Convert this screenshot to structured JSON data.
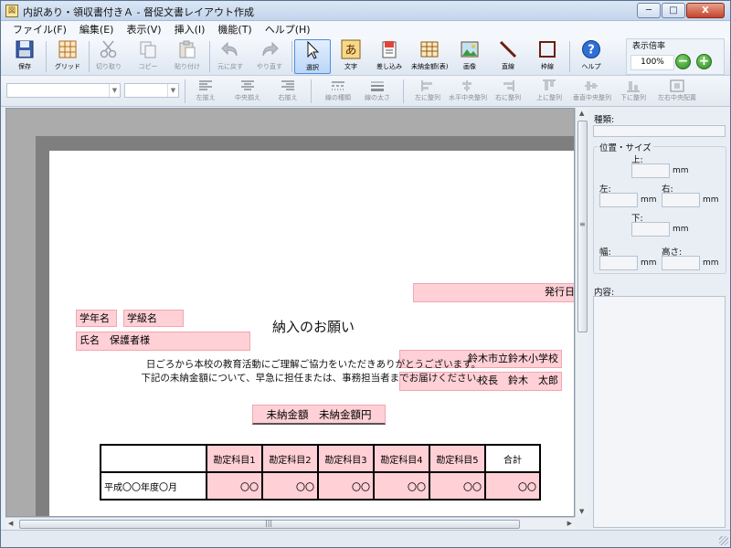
{
  "window": {
    "title": "内訳あり・領収書付きＡ - 督促文書レイアウト作成",
    "icon_text": "図",
    "minimize": "─",
    "maximize": "□",
    "close": "X"
  },
  "menu": [
    {
      "label": "ファイル(F)"
    },
    {
      "label": "編集(E)"
    },
    {
      "label": "表示(V)"
    },
    {
      "label": "挿入(I)"
    },
    {
      "label": "機能(T)"
    },
    {
      "label": "ヘルプ(H)"
    }
  ],
  "toolbar": {
    "save": "保存",
    "grid": "グリッド",
    "cut": "切り取り",
    "copy": "コピー",
    "paste": "貼り付け",
    "undo": "元に戻す",
    "redo": "やり直す",
    "select": "選択",
    "text": "文字",
    "merge": "差し込み",
    "unpaid": "未納金額(表)",
    "image": "画像",
    "line": "直線",
    "frame": "枠線",
    "help": "ヘルプ",
    "zoom_label": "表示倍率",
    "zoom_value": "100%",
    "zoom_out": "−",
    "zoom_in": "+"
  },
  "format_toolbar": {
    "align_left": "左揃え",
    "align_center": "中央揃え",
    "align_right": "右揃え",
    "line_type": "線の種類",
    "line_width": "線の太さ",
    "arr_left": "左に整列",
    "arr_hcenter": "水平中央整列",
    "arr_right": "右に整列",
    "arr_top": "上に整列",
    "arr_vcenter": "垂直中央整列",
    "arr_bottom": "下に整列",
    "arr_lr": "左右中央配置"
  },
  "document": {
    "issue_date": "発行日",
    "grade": "学年名",
    "class": "学級名",
    "name": "氏名　保護者様",
    "school": "鈴木市立鈴木小学校",
    "principal": "校長　鈴木　太郎",
    "title": "納入のお願い",
    "body_line1": "日ごろから本校の教育活動にご理解ご協力をいただきありがとうございます。",
    "body_line2": "下記の未納金額について、早急に担任または、事務担当者までお届けください。",
    "unpaid_amount": "未納金額　未納金額円",
    "table": {
      "headers": [
        "",
        "勘定科目1",
        "勘定科目2",
        "勘定科目3",
        "勘定科目4",
        "勘定科目5",
        "合計"
      ],
      "row": [
        "平成〇〇年度〇月",
        "〇〇",
        "〇〇",
        "〇〇",
        "〇〇",
        "〇〇",
        "〇〇"
      ]
    }
  },
  "panel": {
    "type_label": "種類:",
    "pos_size_label": "位置・サイズ",
    "top": "上:",
    "left": "左:",
    "right": "右:",
    "bottom": "下:",
    "width": "幅:",
    "height": "高さ:",
    "unit": "mm",
    "content_label": "内容:"
  },
  "scroll": {
    "grip": "≡",
    "hgrip": "|||"
  }
}
